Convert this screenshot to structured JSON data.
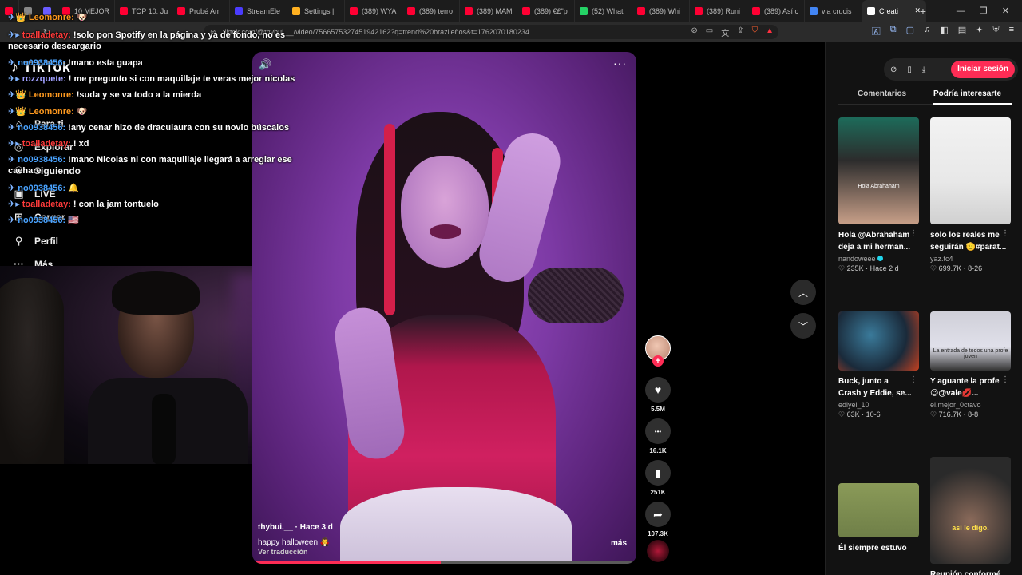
{
  "browser": {
    "tabs": [
      {
        "label": "",
        "color": "#ff0033"
      },
      {
        "label": "",
        "color": "#888888"
      },
      {
        "label": "",
        "color": "#6a5cff"
      },
      {
        "label": "10 MEJOR",
        "color": "#ff0033"
      },
      {
        "label": "TOP 10: Ju",
        "color": "#ff0033"
      },
      {
        "label": "Probé Am",
        "color": "#ff0033"
      },
      {
        "label": "StreamEle",
        "color": "#4b3cff"
      },
      {
        "label": "Settings | ",
        "color": "#ffb020"
      },
      {
        "label": "(389) WYA",
        "color": "#ff0033"
      },
      {
        "label": "(389) terro",
        "color": "#ff0033"
      },
      {
        "label": "(389) MAM",
        "color": "#ff0033"
      },
      {
        "label": "(389) €£\"p",
        "color": "#ff0033"
      },
      {
        "label": "(52) What",
        "color": "#25d366"
      },
      {
        "label": "(389) Whi",
        "color": "#ff0033"
      },
      {
        "label": "(389) Runi",
        "color": "#ff0033"
      },
      {
        "label": "(389) Así c",
        "color": "#ff0033"
      },
      {
        "label": "via crucis",
        "color": "#4285f4"
      },
      {
        "label": "Creati",
        "color": "#ffffff",
        "active": true
      }
    ],
    "url": "tiktok.com/@thybui.__/video/7566575327451942162?q=trend%20brazileños&t=1762070180234",
    "new_tab": "+",
    "win_min": "—",
    "win_max": "❐",
    "win_close": "✕"
  },
  "tiktok": {
    "logo": "TikTok",
    "nav": [
      {
        "label": "Para ti",
        "icon": "home-icon",
        "glyph": "⌂"
      },
      {
        "label": "Explorar",
        "icon": "compass-icon",
        "glyph": "◎"
      },
      {
        "label": "Siguiendo",
        "icon": "following-icon",
        "glyph": "⚇"
      },
      {
        "label": "LIVE",
        "icon": "live-icon",
        "glyph": "▣"
      },
      {
        "label": "Cargar",
        "icon": "upload-icon",
        "glyph": "⊞"
      },
      {
        "label": "Perfil",
        "icon": "profile-icon",
        "glyph": "⚲"
      },
      {
        "label": "Más",
        "icon": "more-icon",
        "glyph": "···"
      }
    ]
  },
  "chat": [
    {
      "badges": "✈👑",
      "user": "Leomonre:",
      "user_color": "#ff9a1f",
      "message": "🐶"
    },
    {
      "badges": "✈▸",
      "user": "toalladetay:",
      "user_color": "#ff3b3b",
      "message": "!solo pon Spotify en la página y ya de fondo, no es necesario descargario"
    },
    {
      "badges": "✈",
      "user": "no0938456:",
      "user_color": "#4aa3ff",
      "message": "!mano esta guapa"
    },
    {
      "badges": "✈▸",
      "user": "rozzquete:",
      "user_color": "#a0a0ff",
      "message": "! me pregunto si con maquillaje te veras mejor nicolas"
    },
    {
      "badges": "✈👑",
      "user": "Leomonre:",
      "user_color": "#ff9a1f",
      "message": "!suda y se va todo a la mierda"
    },
    {
      "badges": "✈👑",
      "user": "Leomonre:",
      "user_color": "#ff9a1f",
      "message": "🐶"
    },
    {
      "badges": "✈",
      "user": "no0938456:",
      "user_color": "#4aa3ff",
      "message": "!any cenar hizo de draculaura con su novio búscalos"
    },
    {
      "badges": "✈▸",
      "user": "toalladetay:",
      "user_color": "#ff3b3b",
      "message": "! xd"
    },
    {
      "badges": "✈",
      "user": "no0938456:",
      "user_color": "#4aa3ff",
      "message": "!mano Nicolas ni con maquillaje llegará a arreglar ese caehare"
    },
    {
      "badges": "✈",
      "user": "no0938456:",
      "user_color": "#4aa3ff",
      "message": "🔔"
    },
    {
      "badges": "✈▸",
      "user": "toalladetay:",
      "user_color": "#ff3b3b",
      "message": "! con la jam tontuelo"
    },
    {
      "badges": "✈",
      "user": "no0938456:",
      "user_color": "#4aa3ff",
      "message": "🇺🇸"
    }
  ],
  "video": {
    "username": "thybui.__ · Hace 3 d",
    "description": "happy halloween 🧛",
    "translate": "Ver traducción",
    "more": "más",
    "volume_icon": "🔊",
    "menu_icon": "···",
    "progress": 0.49
  },
  "actions": {
    "follow": "+",
    "like_count": "5.5M",
    "comment_count": "16.1K",
    "save_count": "251K",
    "share_count": "107.3K",
    "like_glyph": "♥",
    "comment_glyph": "•••",
    "save_glyph": "▮",
    "share_glyph": "➦"
  },
  "nav_arrows": {
    "up": "︿",
    "down": "﹀"
  },
  "right_panel": {
    "login": "Iniciar sesión",
    "tab_comments": "Comentarios",
    "tab_interest": "Podría interesarte",
    "cards": [
      {
        "title1": "Hola @Abrahaham",
        "title2": "deja a mi herman...",
        "author": "nandoweee",
        "verified": true,
        "likes": "235K",
        "date": "Hace 2 d",
        "thumb_text": "Hola Abrahaham"
      },
      {
        "title1": "solo los reales me",
        "title2": "seguirán 🫡#parat...",
        "author": "yaz.tc4",
        "verified": false,
        "likes": "699.7K",
        "date": "8-26",
        "thumb_text": ""
      },
      {
        "title1": "Buck, junto a",
        "title2": "Crash y Eddie, se...",
        "author": "ediyei_10",
        "verified": false,
        "likes": "63K",
        "date": "10-6",
        "thumb_text": ""
      },
      {
        "title1": "Y aguante la profe",
        "title2": "😉@vale💋...",
        "author": "el.mejor_0ctavo",
        "verified": false,
        "likes": "716.7K",
        "date": "8-8",
        "thumb_text": "La entrada de todos una profe joven"
      },
      {
        "title1": "Él siempre estuvo",
        "title2": "",
        "author": "",
        "verified": false,
        "likes": "",
        "date": "",
        "thumb_text": ""
      },
      {
        "title1": "Reunión conformé",
        "title2": "",
        "author": "",
        "verified": false,
        "likes": "",
        "date": "",
        "thumb_text": "así le digo."
      }
    ]
  }
}
